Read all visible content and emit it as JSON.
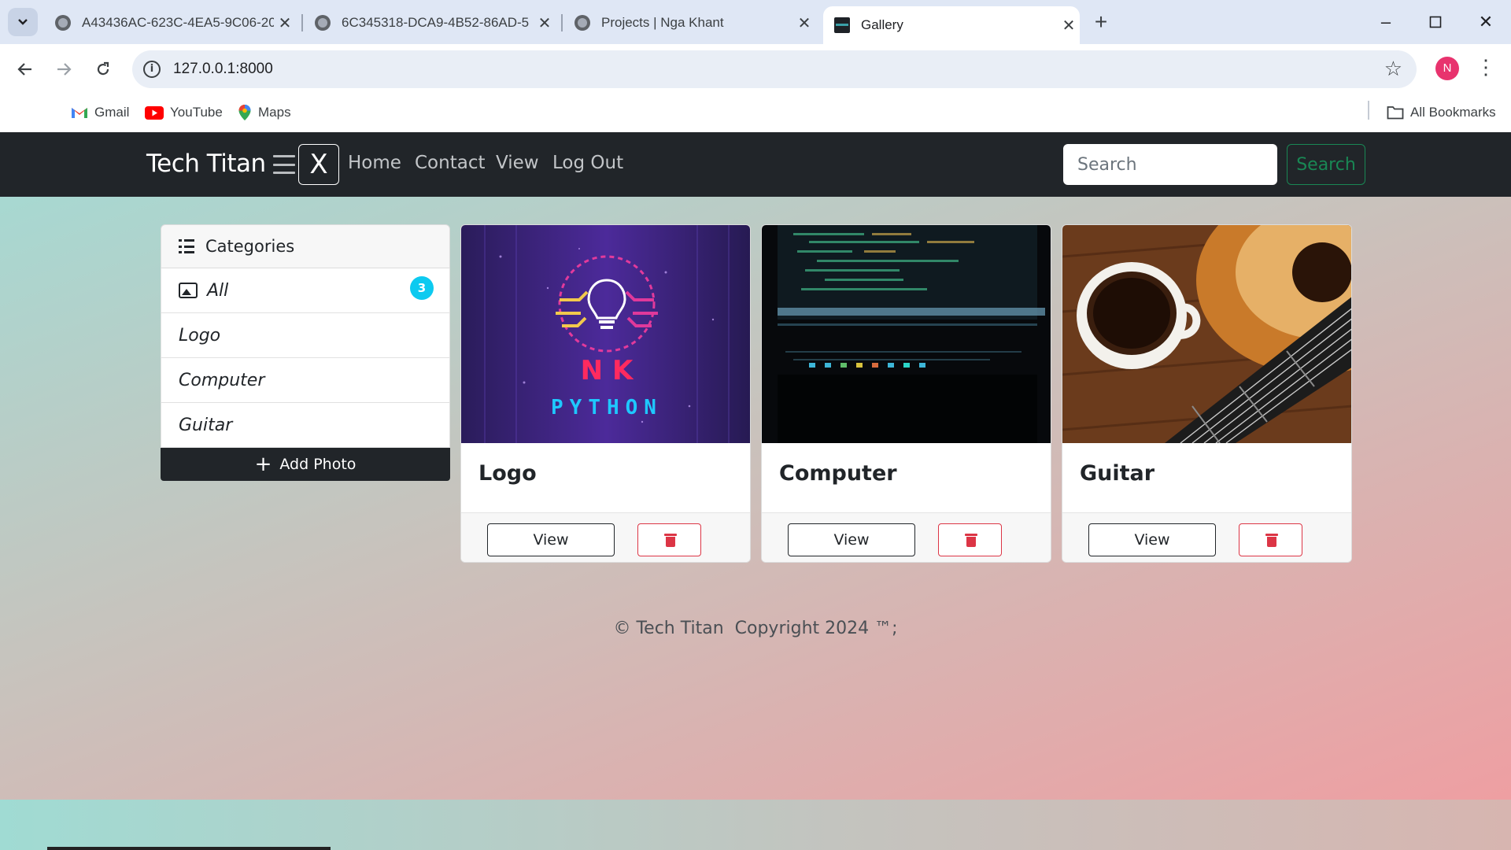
{
  "browser": {
    "tabs": [
      {
        "title": "A43436AC-623C-4EA5-9C06-20",
        "active": false
      },
      {
        "title": "6C345318-DCA9-4B52-86AD-5",
        "active": false
      },
      {
        "title": "Projects | Nga Khant",
        "active": false
      },
      {
        "title": "Gallery",
        "active": true
      }
    ],
    "new_tab": "+",
    "url": "127.0.0.1:8000",
    "profile_initial": "N",
    "bookmarks": [
      {
        "label": "Gmail",
        "icon": "gmail-icon"
      },
      {
        "label": "YouTube",
        "icon": "youtube-icon"
      },
      {
        "label": "Maps",
        "icon": "maps-pin-icon"
      }
    ],
    "all_bookmarks": "All Bookmarks"
  },
  "navbar": {
    "brand": "Tech Titan",
    "close_symbol": "X",
    "links": [
      "Home",
      "Contact",
      "View",
      "Log Out"
    ],
    "search_placeholder": "Search",
    "search_button": "Search"
  },
  "sidebar": {
    "header": "Categories",
    "items": [
      {
        "label": "All",
        "count": "3"
      },
      {
        "label": "Logo"
      },
      {
        "label": "Computer"
      },
      {
        "label": "Guitar"
      }
    ],
    "add_button": "Add Photo"
  },
  "cards": [
    {
      "title": "Logo",
      "view_label": "View",
      "image_text_top": "N K",
      "image_text_bottom": "PYTHON"
    },
    {
      "title": "Computer",
      "view_label": "View"
    },
    {
      "title": "Guitar",
      "view_label": "View"
    }
  ],
  "footer": {
    "text": "© Tech Titan  Copyright 2024 ™;"
  },
  "colors": {
    "navbar_bg": "#212529",
    "badge": "#0dcaf0",
    "search_green": "#198754",
    "danger": "#dc3545",
    "profile": "#e8336e"
  }
}
